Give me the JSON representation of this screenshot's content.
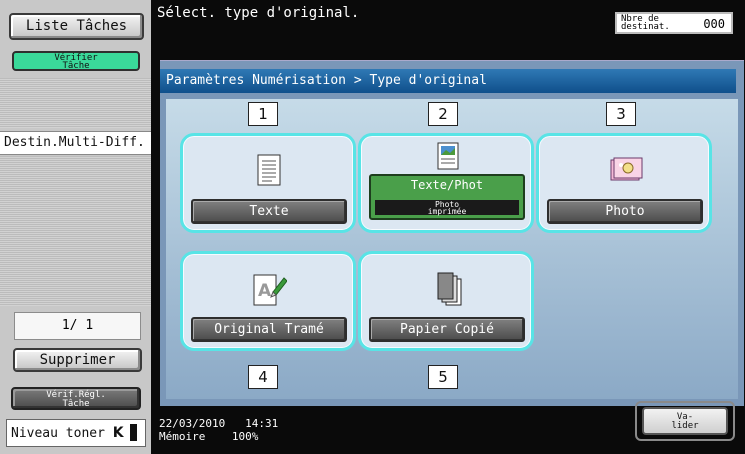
{
  "sidebar": {
    "liste_taches": "Liste Tâches",
    "verifier_tache_line1": "Vérifier",
    "verifier_tache_line2": "Tâche",
    "destin_multi": "Destin.Multi-Diff.",
    "page_count": "1/  1",
    "supprimer": "Supprimer",
    "verif_regl_line1": "Vérif.Régl.",
    "verif_regl_line2": "Tâche",
    "toner_label": "Niveau toner",
    "toner_letter": "K"
  },
  "header": {
    "message": "Sélect. type d'original.",
    "dest_label_line1": "Nbre de",
    "dest_label_line2": "destinat.",
    "dest_value": "000"
  },
  "panel": {
    "breadcrumb": "Paramètres Numérisation > Type d'original",
    "options": [
      {
        "number": "1",
        "label": "Texte",
        "icon": "text-document-icon"
      },
      {
        "number": "2",
        "label": "Texte/Phot",
        "sub_line1": "Photo",
        "sub_line2": "imprimée",
        "icon": "text-photo-document-icon",
        "selected": true
      },
      {
        "number": "3",
        "label": "Photo",
        "icon": "photo-icon"
      },
      {
        "number": "4",
        "label": "Original Tramé",
        "icon": "dot-matrix-document-icon"
      },
      {
        "number": "5",
        "label": "Papier Copié",
        "icon": "copied-paper-stack-icon"
      }
    ]
  },
  "footer": {
    "date": "22/03/2010",
    "time": "14:31",
    "memory_label": "Mémoire",
    "memory_value": "100%",
    "valider_line1": "Va-",
    "valider_line2": "lider"
  },
  "colors": {
    "selected_green": "#4a9f4a",
    "card_border": "#58e4e6",
    "breadcrumb_blue": "#1f66a6",
    "verify_green": "#3ad99a"
  }
}
